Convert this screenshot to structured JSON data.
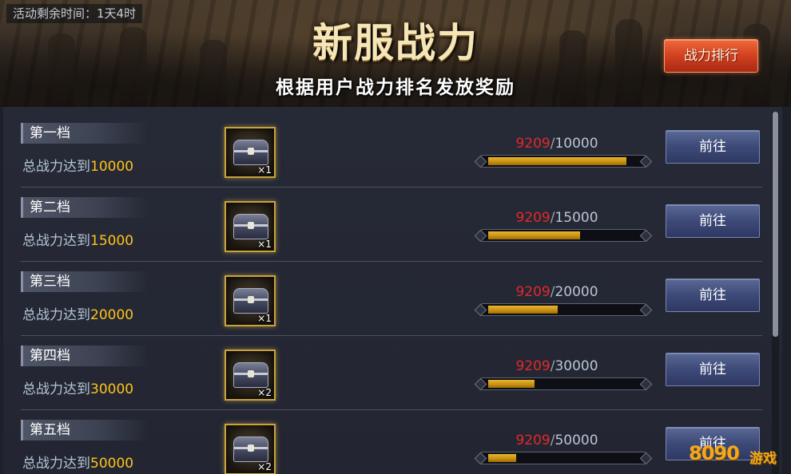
{
  "event": {
    "timer_text": "活动剩余时间：1天4时",
    "title": "新服战力",
    "subtitle": "根据用户战力排名发放奖励",
    "rank_button": "战力排行"
  },
  "tiers": [
    {
      "name": "第一档",
      "req_prefix": "总战力达到",
      "req_value": "10000",
      "reward_qty": "×1",
      "current": "9209",
      "slash": "/",
      "target": "10000",
      "progress": 0.9209,
      "button": "前往"
    },
    {
      "name": "第二档",
      "req_prefix": "总战力达到",
      "req_value": "15000",
      "reward_qty": "×1",
      "current": "9209",
      "slash": "/",
      "target": "15000",
      "progress": 0.6139,
      "button": "前往"
    },
    {
      "name": "第三档",
      "req_prefix": "总战力达到",
      "req_value": "20000",
      "reward_qty": "×1",
      "current": "9209",
      "slash": "/",
      "target": "20000",
      "progress": 0.4605,
      "button": "前往"
    },
    {
      "name": "第四档",
      "req_prefix": "总战力达到",
      "req_value": "30000",
      "reward_qty": "×2",
      "current": "9209",
      "slash": "/",
      "target": "30000",
      "progress": 0.307,
      "button": "前往"
    },
    {
      "name": "第五档",
      "req_prefix": "总战力达到",
      "req_value": "50000",
      "reward_qty": "×2",
      "current": "9209",
      "slash": "/",
      "target": "50000",
      "progress": 0.1842,
      "button": "前往"
    }
  ],
  "watermark": {
    "digits": "8090",
    "word": "游戏"
  },
  "colors": {
    "current_value": "#e3282a",
    "requirement_value": "#ffc21a",
    "progress_fill": "#d9a21f",
    "rank_button": "#d2401f",
    "go_button": "#3d4a78"
  }
}
